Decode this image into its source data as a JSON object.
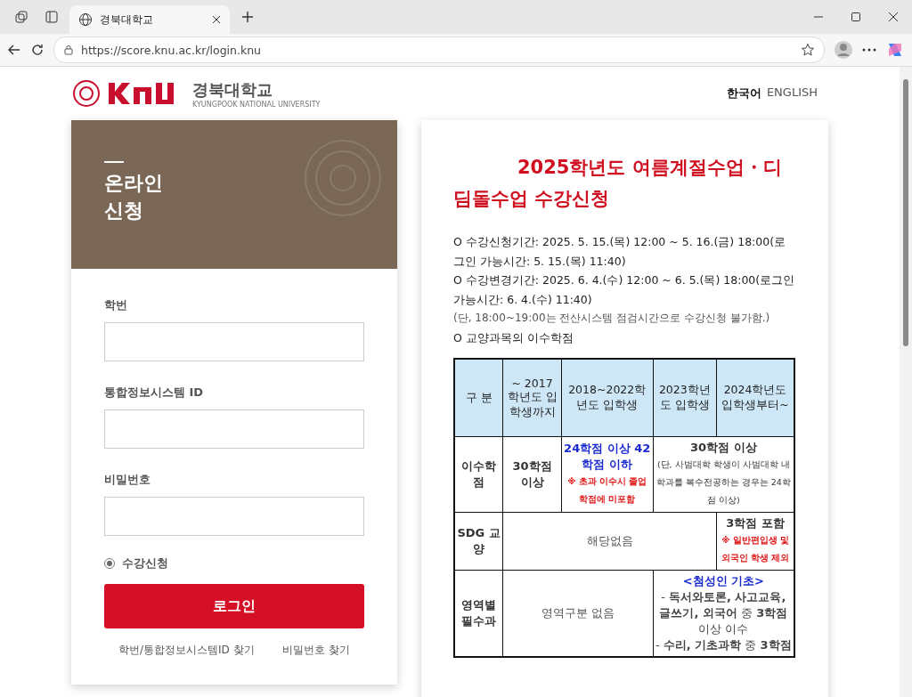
{
  "browser": {
    "tab_title": "경북대학교",
    "url": "https://score.knu.ac.kr/login.knu"
  },
  "header": {
    "logo_text": "경북대학교",
    "logo_sub": "KYUNGPOOK NATIONAL UNIVERSITY",
    "languages": [
      {
        "label": "한국어",
        "selected": true
      },
      {
        "label": "ENGLISH",
        "selected": false
      }
    ]
  },
  "login": {
    "banner_title": [
      "온라인",
      "신청"
    ],
    "fields": [
      {
        "label": "학번"
      },
      {
        "label": "통합정보시스템 ID"
      },
      {
        "label": "비밀번호"
      }
    ],
    "options": [
      {
        "label": "수강신청",
        "selected": true
      }
    ],
    "submit": "로그인",
    "links": [
      "학번/통합정보시스템ID 찾기",
      "비밀번호 찾기"
    ]
  },
  "notice": {
    "title": "2025학년도 여름계절수업・디딤돌수업 수강신청",
    "lines": [
      {
        "kind": "item",
        "text": "O  수강신청기간: 2025. 5. 15.(목) 12:00 ~ 5. 16.(금) 18:00(로그인 가능시간: 5. 15.(목) 11:40)"
      },
      {
        "kind": "item",
        "text": "O  수강변경기간: 2025. 6. 4.(수) 12:00 ~ 6. 5.(목) 18:00(로그인 가능시간: 6. 4.(수) 11:40)"
      },
      {
        "kind": "remark",
        "text": "(단, 18:00~19:00는 전산시스템 점검시간으로 수강신청 불가함.)"
      },
      {
        "kind": "item",
        "text": "O  교양과목의 이수학점"
      }
    ],
    "table": {
      "columns": [
        "구 분",
        "~ 2017 학년도 입학생까지",
        "2018~2022학년도 입학생",
        "2023학년도 입학생",
        "2024학년도 입학생부터~"
      ],
      "rows": [
        [
          {
            "parts": [
              {
                "kind": "head",
                "text": "이수학점"
              }
            ]
          },
          {
            "parts": [
              {
                "kind": "head",
                "text": "30학점 이상"
              }
            ]
          },
          {
            "parts": [
              {
                "kind": "blue",
                "text": "24학점 이상 42학점 이하"
              },
              {
                "kind": "red",
                "text": "※ 초과 이수시 졸업학점에 미포함"
              }
            ]
          },
          {
            "colspan": 2,
            "parts": [
              {
                "kind": "head",
                "text": "30학점 이상"
              },
              {
                "kind": "small",
                "text": "(단, 사범대학 학생이 사범대학 내 학과를 복수전공하는 경우는 24학점 이상)"
              }
            ]
          }
        ],
        [
          {
            "parts": [
              {
                "kind": "head",
                "text": "SDG 교양"
              }
            ]
          },
          {
            "colspan": 3,
            "parts": [
              {
                "kind": "plain",
                "text": "해당없음"
              }
            ]
          },
          {
            "parts": [
              {
                "kind": "head",
                "text": "3학점 포함"
              },
              {
                "kind": "red",
                "text": "※ 일반편입생 및 외국인 학생 제외"
              }
            ]
          }
        ],
        [
          {
            "parts": [
              {
                "kind": "head",
                "text": "영역별 필수과"
              }
            ]
          },
          {
            "colspan": 2,
            "parts": [
              {
                "kind": "plain",
                "text": "영역구분 없음"
              }
            ]
          },
          {
            "colspan": 2,
            "parts": [
              {
                "kind": "blue",
                "text": "<첨성인 기초>"
              },
              {
                "kind": "mixed",
                "text": "- **독서와토론, 사고교육, 글쓰기, 외국어** 중 **3학점** 이상 이수"
              },
              {
                "kind": "mixed",
                "text": "- **수리, 기초과학** 중 **3학점**"
              }
            ]
          }
        ]
      ]
    }
  }
}
